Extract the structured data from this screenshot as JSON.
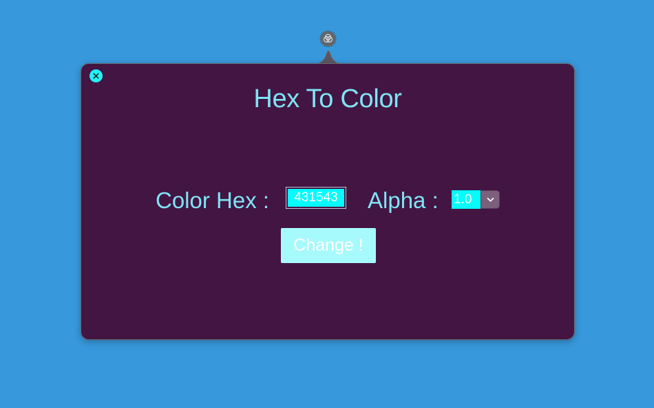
{
  "popover": {
    "title": "Hex To Color",
    "background_color": "#431543"
  },
  "form": {
    "hex_label": "Color Hex :",
    "hex_value": "431543",
    "alpha_label": "Alpha :",
    "alpha_value": "1.0",
    "change_button": "Change !"
  },
  "icons": {
    "status_item": "overlapping-circles-icon",
    "close": "close-icon",
    "dropdown": "chevron-down-icon"
  },
  "colors": {
    "desktop": "#3798DB",
    "accent_text": "#7FE4F4",
    "field_fill": "#04FCFC",
    "button_fill": "#A7FAFB",
    "close_fill": "#1EF4F8"
  }
}
